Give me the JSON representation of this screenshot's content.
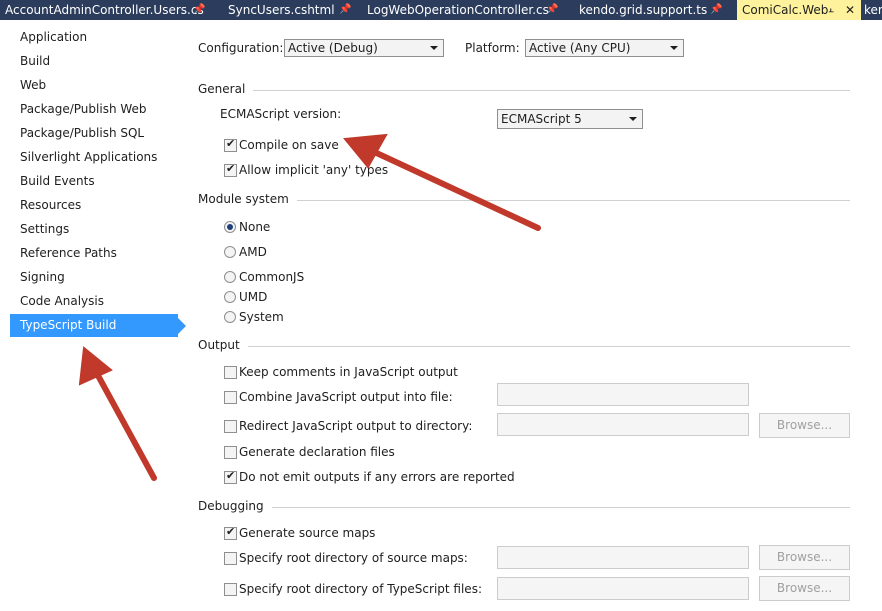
{
  "tabs": [
    {
      "label": "AccountAdminController.Users.cs"
    },
    {
      "label": "SyncUsers.cshtml"
    },
    {
      "label": "LogWebOperationController.cs"
    },
    {
      "label": "kendo.grid.support.ts"
    },
    {
      "label": "ComiCalc.Web"
    },
    {
      "label": "ken"
    }
  ],
  "sidebar": {
    "items": [
      {
        "label": "Application"
      },
      {
        "label": "Build"
      },
      {
        "label": "Web"
      },
      {
        "label": "Package/Publish Web"
      },
      {
        "label": "Package/Publish SQL"
      },
      {
        "label": "Silverlight Applications"
      },
      {
        "label": "Build Events"
      },
      {
        "label": "Resources"
      },
      {
        "label": "Settings"
      },
      {
        "label": "Reference Paths"
      },
      {
        "label": "Signing"
      },
      {
        "label": "Code Analysis"
      },
      {
        "label": "TypeScript Build",
        "selected": true
      }
    ]
  },
  "top": {
    "configuration_label": "Configuration:",
    "configuration_value": "Active (Debug)",
    "platform_label": "Platform:",
    "platform_value": "Active (Any CPU)"
  },
  "general": {
    "title": "General",
    "ecma_label": "ECMAScript version:",
    "ecma_value": "ECMAScript 5",
    "compile_on_save": {
      "label": "Compile on save",
      "checked": true
    },
    "allow_implicit_any": {
      "label": "Allow implicit 'any' types",
      "checked": true
    }
  },
  "module": {
    "title": "Module system",
    "options": [
      {
        "label": "None",
        "selected": true
      },
      {
        "label": "AMD",
        "selected": false
      },
      {
        "label": "CommonJS",
        "selected": false
      },
      {
        "label": "UMD",
        "selected": false
      },
      {
        "label": "System",
        "selected": false
      }
    ]
  },
  "output": {
    "title": "Output",
    "keep_comments": {
      "label": "Keep comments in JavaScript output",
      "checked": false
    },
    "combine_output": {
      "label": "Combine JavaScript output into file:",
      "checked": false
    },
    "redirect_output": {
      "label": "Redirect JavaScript output to directory:",
      "checked": false
    },
    "generate_declarations": {
      "label": "Generate declaration files",
      "checked": false
    },
    "no_emit_on_error": {
      "label": "Do not emit outputs if any errors are reported",
      "checked": true
    },
    "browse_label": "Browse..."
  },
  "debugging": {
    "title": "Debugging",
    "source_maps": {
      "label": "Generate source maps",
      "checked": true
    },
    "source_maps_root": {
      "label": "Specify root directory of source maps:",
      "checked": false
    },
    "ts_root": {
      "label": "Specify root directory of TypeScript files:",
      "checked": false
    },
    "browse_label": "Browse..."
  },
  "colors": {
    "tab_bar": "#2b3c5c",
    "active_tab": "#fff29d",
    "selection": "#3399ff",
    "annotation_arrow": "#c0392b"
  }
}
